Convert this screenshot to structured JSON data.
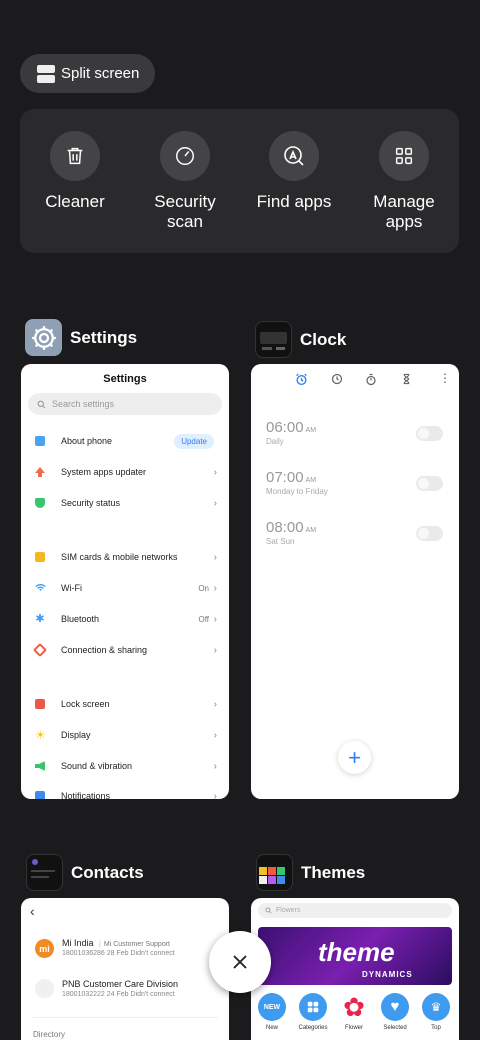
{
  "split_screen": {
    "label": "Split screen"
  },
  "tools": [
    {
      "label": "Cleaner",
      "icon": "trash-icon"
    },
    {
      "label": "Security scan",
      "icon": "speedometer-icon"
    },
    {
      "label": "Find apps",
      "icon": "search-app-icon"
    },
    {
      "label": "Manage apps",
      "icon": "grid-icon"
    }
  ],
  "apps": {
    "settings": {
      "name": "Settings",
      "title": "Settings",
      "search_placeholder": "Search settings",
      "rows": [
        {
          "label": "About phone",
          "badge": "Update",
          "color": "#4aa3f5"
        },
        {
          "label": "System apps updater",
          "color": "#f06a4d"
        },
        {
          "label": "Security status",
          "color": "#3ac46e"
        },
        {
          "label": "SIM cards & mobile networks",
          "color": "#f5b720"
        },
        {
          "label": "Wi-Fi",
          "value": "On",
          "color": "#3f9bf0"
        },
        {
          "label": "Bluetooth",
          "value": "Off",
          "color": "#3f9bf0"
        },
        {
          "label": "Connection & sharing",
          "color": "#f05b45"
        },
        {
          "label": "Lock screen",
          "color": "#ee5a4a"
        },
        {
          "label": "Display",
          "color": "#f5c120"
        },
        {
          "label": "Sound & vibration",
          "color": "#3ac46e"
        },
        {
          "label": "Notifications",
          "color": "#3f8cf0"
        }
      ]
    },
    "clock": {
      "name": "Clock",
      "alarms": [
        {
          "time": "06:00",
          "ampm": "AM",
          "repeat": "Daily"
        },
        {
          "time": "07:00",
          "ampm": "AM",
          "repeat": "Monday to Friday"
        },
        {
          "time": "08:00",
          "ampm": "AM",
          "repeat": "Sat Sun"
        }
      ]
    },
    "contacts": {
      "name": "Contacts",
      "entries": [
        {
          "name": "Mi India",
          "tag": "Mi Customer Support",
          "number": "18001036286",
          "detail": "28 Feb Didn't connect"
        },
        {
          "name": "PNB Customer Care Division",
          "number": "18001032222",
          "detail": "24 Feb Didn't connect"
        }
      ],
      "section": "Directory"
    },
    "themes": {
      "name": "Themes",
      "search_placeholder": "Flowers",
      "banner_title": "theme",
      "banner_sub": "DYNAMICS",
      "categories": [
        "New",
        "Categories",
        "Flower",
        "Selected",
        "Top"
      ]
    }
  }
}
